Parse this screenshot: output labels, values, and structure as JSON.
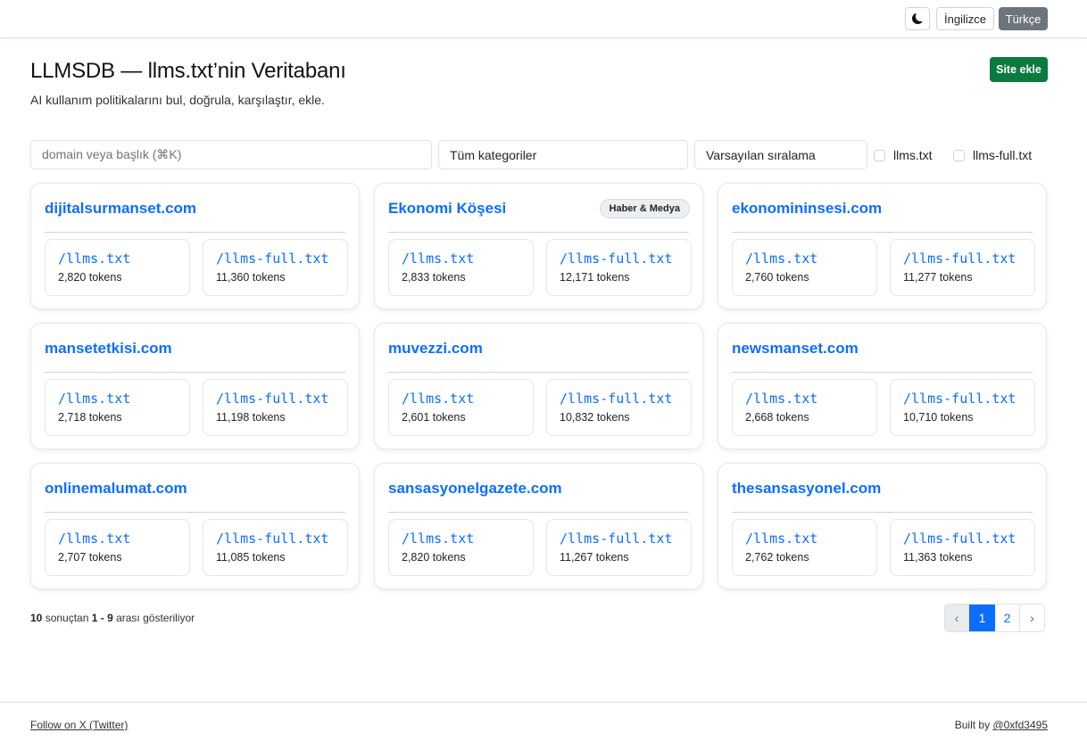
{
  "topbar": {
    "theme_icon": "moon-icon",
    "lang_en": "İngilizce",
    "lang_tr": "Türkçe"
  },
  "header": {
    "title": "LLMSDB — llms.txt’nin Veritabanı",
    "subtitle": "AI kullanım politikalarını bul, doğrula, karşılaştır, ekle.",
    "add_button": "Site ekle"
  },
  "filters": {
    "search_placeholder": "domain veya başlık (⌘K)",
    "category": "Tüm kategoriler",
    "sort": "Varsayılan sıralama",
    "check_llms": "llms.txt",
    "check_llms_full": "llms-full.txt"
  },
  "cards": [
    {
      "title": "dijitalsurmanset.com",
      "badge": "",
      "files": [
        {
          "name": "/llms.txt",
          "tokens": "2,820 tokens"
        },
        {
          "name": "/llms-full.txt",
          "tokens": "11,360 tokens"
        }
      ]
    },
    {
      "title": "Ekonomi Köşesi",
      "badge": "Haber & Medya",
      "files": [
        {
          "name": "/llms.txt",
          "tokens": "2,833 tokens"
        },
        {
          "name": "/llms-full.txt",
          "tokens": "12,171 tokens"
        }
      ]
    },
    {
      "title": "ekonomininsesi.com",
      "badge": "",
      "files": [
        {
          "name": "/llms.txt",
          "tokens": "2,760 tokens"
        },
        {
          "name": "/llms-full.txt",
          "tokens": "11,277 tokens"
        }
      ]
    },
    {
      "title": "mansetetkisi.com",
      "badge": "",
      "files": [
        {
          "name": "/llms.txt",
          "tokens": "2,718 tokens"
        },
        {
          "name": "/llms-full.txt",
          "tokens": "11,198 tokens"
        }
      ]
    },
    {
      "title": "muvezzi.com",
      "badge": "",
      "files": [
        {
          "name": "/llms.txt",
          "tokens": "2,601 tokens"
        },
        {
          "name": "/llms-full.txt",
          "tokens": "10,832 tokens"
        }
      ]
    },
    {
      "title": "newsmanset.com",
      "badge": "",
      "files": [
        {
          "name": "/llms.txt",
          "tokens": "2,668 tokens"
        },
        {
          "name": "/llms-full.txt",
          "tokens": "10,710 tokens"
        }
      ]
    },
    {
      "title": "onlinemalumat.com",
      "badge": "",
      "files": [
        {
          "name": "/llms.txt",
          "tokens": "2,707 tokens"
        },
        {
          "name": "/llms-full.txt",
          "tokens": "11,085 tokens"
        }
      ]
    },
    {
      "title": "sansasyonelgazete.com",
      "badge": "",
      "files": [
        {
          "name": "/llms.txt",
          "tokens": "2,820 tokens"
        },
        {
          "name": "/llms-full.txt",
          "tokens": "11,267 tokens"
        }
      ]
    },
    {
      "title": "thesansasyonel.com",
      "badge": "",
      "files": [
        {
          "name": "/llms.txt",
          "tokens": "2,762 tokens"
        },
        {
          "name": "/llms-full.txt",
          "tokens": "11,363 tokens"
        }
      ]
    }
  ],
  "results": {
    "total": "10",
    "text_a": " sonuçtan ",
    "range": "1 - 9",
    "text_b": " arası gösteriliyor"
  },
  "pagination": {
    "prev": "‹",
    "page1": "1",
    "page2": "2",
    "next": "›"
  },
  "footer": {
    "follow": "Follow on X (Twitter)",
    "built_prefix": "Built by ",
    "built_handle": "@0xfd3495"
  },
  "colors": {
    "accent": "#0d6efd",
    "add_button": "#0a7a3e",
    "active_lang": "#6c757d"
  }
}
